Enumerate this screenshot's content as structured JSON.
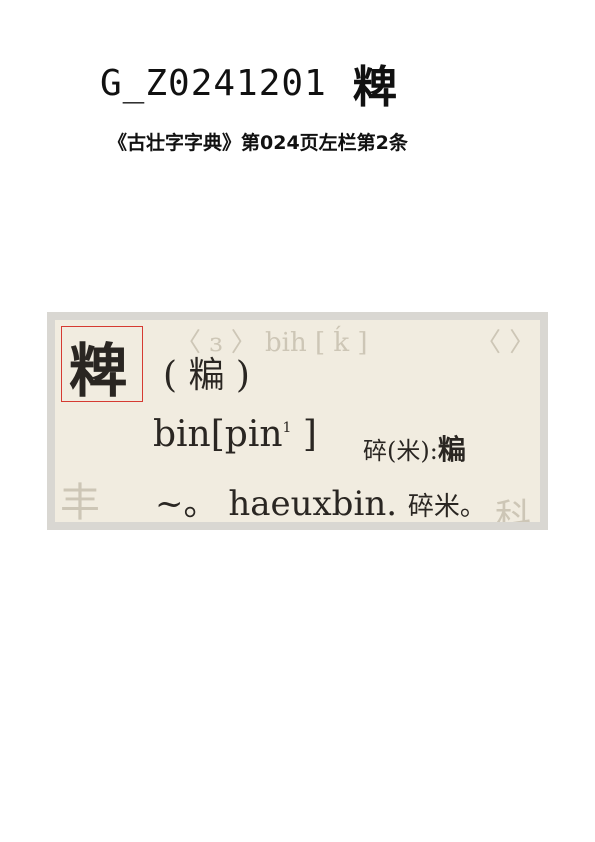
{
  "header": {
    "code": "G_Z0241201",
    "character": "粺"
  },
  "subtitle": "《古壮字字典》第024页左栏第2条",
  "entry": {
    "headword": "粺",
    "variant": "( 糄 )",
    "pronunciation": "bin[pin",
    "tone": "1",
    "pron_close": "]",
    "gloss": "碎(米):",
    "gloss_char": "糄",
    "example_prefix": "~。",
    "example_word": "haeuxbin.",
    "example_gloss": "碎米。"
  },
  "colors": {
    "headword_box": "#d63a32",
    "scan_paper": "#f1ece0",
    "scan_frame": "#d9d7d2"
  }
}
